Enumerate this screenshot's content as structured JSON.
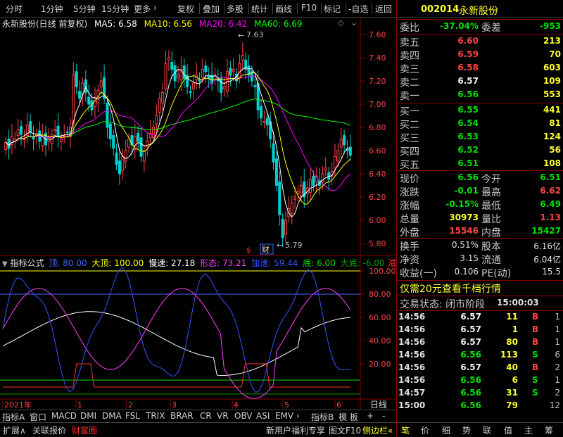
{
  "toolbar": {
    "left_items": [
      "分时",
      "1分钟",
      "5分钟",
      "15分钟",
      "更多"
    ],
    "right_items": [
      "复权",
      "叠加",
      "多股",
      "统计",
      "画线",
      "F10",
      "标记",
      "-自选",
      "返回"
    ],
    "more_arrow": "›"
  },
  "chart_header": {
    "title": "永新股份(日线 前复权)",
    "ma5": "MA5: 6.58",
    "ma10": "MA10: 6.56",
    "ma20": "MA20: 6.42",
    "ma60": "MA60: 6.69",
    "ma5_color": "#ffffff",
    "ma10_color": "#ffff00",
    "ma20_color": "#ff00ff",
    "ma60_color": "#00ff00"
  },
  "price_axis": [
    "7.60",
    "7.40",
    "7.20",
    "7.00",
    "6.80",
    "6.60",
    "6.40",
    "6.20",
    "6.00",
    "5.80"
  ],
  "annotations": {
    "high": "7.63",
    "low": "5.79",
    "dollar": "$",
    "cai": "财"
  },
  "indicator_header": {
    "name": "指标公式",
    "ding": "顶: 80.00",
    "dading": "大顶: 100.00",
    "mansu": "慢速: 27.18",
    "xingtai": "形态: 73.21",
    "jiasu": "加速: 59.44",
    "di": "底: 6.00",
    "dadi": "大底: -6.00",
    "tail": "滋"
  },
  "indicator_axis": [
    "100.00",
    "80.00",
    "60.00",
    "40.00",
    "20.00"
  ],
  "x_axis": {
    "labels": [
      "2021年",
      "1",
      "2",
      "3",
      "4",
      "5",
      "6"
    ],
    "right_label": "日线"
  },
  "tabs": [
    "指标A",
    "窗口",
    "MACD",
    "DMI",
    "DMA",
    "FSL",
    "TRIX",
    "BRAR",
    "CR",
    "VR",
    "OBV",
    "ASI",
    "EMV",
    "指标B",
    "模 板",
    "+",
    "-"
  ],
  "tab_arrow": "›",
  "bottom_left": [
    "扩展∧",
    "关联报价",
    "财富圈"
  ],
  "bottom_mid": [
    "新用户福利专享",
    "图文F10",
    "侧边栏«"
  ],
  "bottom_right": [
    "笔",
    "价",
    "细",
    "势",
    "联",
    "值",
    "主",
    "筹"
  ],
  "stock": {
    "code": "002014",
    "name": "永新股份"
  },
  "weibi": {
    "label": "委比",
    "value": "-37.04%",
    "label2": "委差",
    "value2": "-953"
  },
  "sell": [
    {
      "label": "卖五",
      "price": "6.60",
      "vol": "213"
    },
    {
      "label": "卖四",
      "price": "6.59",
      "vol": "70"
    },
    {
      "label": "卖三",
      "price": "6.58",
      "vol": "603"
    },
    {
      "label": "卖二",
      "price": "6.57",
      "vol": "109"
    },
    {
      "label": "卖一",
      "price": "6.56",
      "vol": "553"
    }
  ],
  "buy": [
    {
      "label": "买一",
      "price": "6.55",
      "vol": "441"
    },
    {
      "label": "买二",
      "price": "6.54",
      "vol": "81"
    },
    {
      "label": "买三",
      "price": "6.53",
      "vol": "124"
    },
    {
      "label": "买四",
      "price": "6.52",
      "vol": "56"
    },
    {
      "label": "买五",
      "price": "6.51",
      "vol": "108"
    }
  ],
  "quote": [
    {
      "l1": "现价",
      "v1": "6.56",
      "c1": "green",
      "l2": "今开",
      "v2": "6.51",
      "c2": "green"
    },
    {
      "l1": "涨跌",
      "v1": "-0.01",
      "c1": "green",
      "l2": "最高",
      "v2": "6.62",
      "c2": "red"
    },
    {
      "l1": "涨幅",
      "v1": "-0.15%",
      "c1": "green",
      "l2": "最低",
      "v2": "6.49",
      "c2": "green"
    },
    {
      "l1": "总量",
      "v1": "30973",
      "c1": "yellow",
      "l2": "量比",
      "v2": "1.13",
      "c2": "red"
    },
    {
      "l1": "外盘",
      "v1": "15546",
      "c1": "red",
      "l2": "内盘",
      "v2": "15427",
      "c2": "green"
    }
  ],
  "fund": [
    {
      "l1": "换手",
      "v1": "0.51%",
      "l2": "股本",
      "v2": "6.16亿"
    },
    {
      "l1": "净资",
      "v1": "3.15",
      "l2": "流通",
      "v2": "6.04亿"
    },
    {
      "l1": "收益(一)",
      "v1": "0.106",
      "l2": "PE(动)",
      "v2": "15.5"
    }
  ],
  "promo": "仅需20元查看千档行情",
  "trade_status": {
    "label": "交易状态: 闭市阶段",
    "time": "15:00:03"
  },
  "ticks": [
    {
      "time": "14:56",
      "price": "6.57",
      "pc": "white",
      "vol": "11",
      "bs": "B",
      "n": "1"
    },
    {
      "time": "14:56",
      "price": "6.57",
      "pc": "white",
      "vol": "1",
      "bs": "B",
      "n": "1"
    },
    {
      "time": "14:56",
      "price": "6.57",
      "pc": "white",
      "vol": "80",
      "bs": "B",
      "n": "1"
    },
    {
      "time": "14:56",
      "price": "6.56",
      "pc": "green",
      "vol": "113",
      "bs": "S",
      "n": "6"
    },
    {
      "time": "14:56",
      "price": "6.57",
      "pc": "white",
      "vol": "40",
      "bs": "B",
      "n": "2"
    },
    {
      "time": "14:56",
      "price": "6.56",
      "pc": "green",
      "vol": "6",
      "bs": "S",
      "n": "1"
    },
    {
      "time": "14:57",
      "price": "6.56",
      "pc": "green",
      "vol": "31",
      "bs": "S",
      "n": "2"
    },
    {
      "time": "15:00",
      "price": "6.56",
      "pc": "green",
      "vol": "79",
      "bs": "",
      "n": "12"
    }
  ]
}
